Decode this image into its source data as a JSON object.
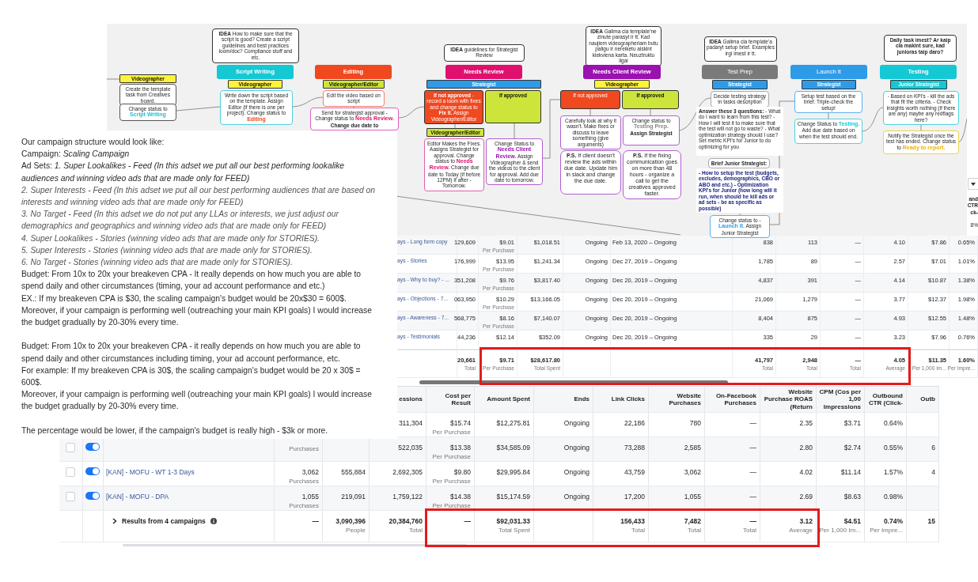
{
  "flowchart": {
    "nodes": [
      {
        "kind": "role",
        "color": "#fff23a",
        "parts": [
          {
            "kind": "bold",
            "text": "Videographer"
          }
        ]
      },
      {
        "kind": "note",
        "color": "#555555",
        "parts": [
          {
            "kind": "plain",
            "text": "Create the template task from Creatives board."
          }
        ]
      },
      {
        "kind": "note",
        "color": "#555555",
        "parts": [
          {
            "kind": "plain",
            "text": "Change status to"
          },
          {
            "kind": "colored",
            "color": "#1fc0d8",
            "text": "Script Writing"
          }
        ]
      },
      {
        "kind": "note",
        "color": "#333333",
        "parts": [
          {
            "kind": "bold",
            "text": "IDEA"
          },
          {
            "kind": "plain",
            "text": "How to make sure that the script is good? Create a script guidelines and best practices loom/doc? Compliance stuff and etc."
          }
        ]
      },
      {
        "kind": "stage",
        "color": "#14c8d4",
        "parts": [
          {
            "kind": "bold",
            "text": "Script Writing"
          }
        ]
      },
      {
        "kind": "role",
        "color": "#fff23a",
        "parts": [
          {
            "kind": "bold",
            "text": "Videographer"
          }
        ]
      },
      {
        "kind": "note",
        "color": "#4fd0e0",
        "parts": [
          {
            "kind": "plain",
            "text": "Write down the script based on the template. Assign Editor (if there is one per project). Change status to"
          },
          {
            "kind": "colored",
            "color": "#f0481f",
            "text": "Editing"
          }
        ]
      },
      {
        "kind": "stage",
        "color": "#f0481f",
        "parts": [
          {
            "kind": "bold",
            "text": "Editing"
          }
        ]
      },
      {
        "kind": "role",
        "color": "#cde53a",
        "parts": [
          {
            "kind": "bold",
            "text": "Videographer/Editor"
          }
        ]
      },
      {
        "kind": "note",
        "color": "#f08070",
        "parts": [
          {
            "kind": "plain",
            "text": "Edit the video based on script"
          }
        ]
      },
      {
        "kind": "note",
        "color": "#e060c0",
        "parts": [
          {
            "kind": "plain",
            "text": "Send for strategist approval - Change status to"
          },
          {
            "kind": "status",
            "color": "#e0106e",
            "text": "Needs Review."
          },
          {
            "kind": "bold",
            "text": "Change due date to"
          }
        ]
      },
      {
        "kind": "note",
        "color": "#333333",
        "parts": [
          {
            "kind": "bold",
            "text": "IDEA"
          },
          {
            "kind": "plain",
            "text": "guidelines for Strategist Review"
          }
        ]
      },
      {
        "kind": "stage",
        "color": "#e0106e",
        "parts": [
          {
            "kind": "bold",
            "text": "Needs Review"
          }
        ]
      },
      {
        "kind": "role",
        "color": "#2d9be8",
        "parts": [
          {
            "kind": "bold",
            "text": "Strategist"
          }
        ]
      },
      {
        "kind": "decision",
        "color": "#f0481f",
        "parts": [
          {
            "kind": "bold",
            "text": "If not approved"
          },
          {
            "kind": "plain",
            "text": "- record a loom with fixes and change status to"
          },
          {
            "kind": "bold",
            "text": "Fix It."
          },
          {
            "kind": "plain",
            "text": "Assign Videographer/Editor"
          }
        ]
      },
      {
        "kind": "decision",
        "color": "#cde53a",
        "parts": [
          {
            "kind": "bold",
            "text": "If approved"
          }
        ]
      },
      {
        "kind": "role",
        "color": "#cde53a",
        "parts": [
          {
            "kind": "bold",
            "text": "Videographer/Editor"
          }
        ]
      },
      {
        "kind": "note",
        "color": "#e060b0",
        "parts": [
          {
            "kind": "plain",
            "text": "Editor Makes the Fixes. Aasigns Strategist for approval. Change status to"
          },
          {
            "kind": "status",
            "color": "#e0106e",
            "text": "Needs Review."
          },
          {
            "kind": "plain",
            "text": "Change due date to Today (if before 12PM) If after - Tomorrow."
          }
        ]
      },
      {
        "kind": "note",
        "color": "#b060d0",
        "parts": [
          {
            "kind": "plain",
            "text": "Change Status to"
          },
          {
            "kind": "colored",
            "color": "#9a12b0",
            "text": "Needs Client Review."
          },
          {
            "kind": "plain",
            "text": "Assign Videographer & send the videos to the client for approval. Add due date to tomorrow."
          }
        ]
      },
      {
        "kind": "note",
        "color": "#333333",
        "parts": [
          {
            "kind": "bold",
            "text": "IDEA"
          },
          {
            "kind": "plain",
            "text": "Galima cia template'ne zinute parasyt ir tt. Kad naujiem videographeriam butu paligu ir nereiketu aiskint kiekviena karta. Neuztruktu ilgai"
          }
        ]
      },
      {
        "kind": "stage",
        "color": "#9a12b0",
        "parts": [
          {
            "kind": "bold",
            "text": "Needs Client Review"
          }
        ]
      },
      {
        "kind": "role",
        "color": "#fff23a",
        "parts": [
          {
            "kind": "bold",
            "text": "Videographer"
          }
        ]
      },
      {
        "kind": "decision",
        "color": "#f0481f",
        "parts": [
          {
            "kind": "plain",
            "text": "If not approved"
          }
        ]
      },
      {
        "kind": "decision",
        "color": "#cde53a",
        "parts": [
          {
            "kind": "bold",
            "text": "If approved"
          }
        ]
      },
      {
        "kind": "note",
        "color": "#b060d0",
        "parts": [
          {
            "kind": "plain",
            "text": "Carefully look at why it wasn't. Make fixes or discuss to leave something (give arguments)"
          }
        ]
      },
      {
        "kind": "note",
        "color": "#b060d0",
        "parts": [
          {
            "kind": "plain",
            "text": "Change status to"
          },
          {
            "kind": "colored",
            "color": "#888888",
            "text": "Testing Prep."
          },
          {
            "kind": "bold",
            "text": "Assign Strategist"
          }
        ]
      },
      {
        "kind": "callout",
        "color": "#b060d0",
        "parts": [
          {
            "kind": "bold",
            "text": "P.S."
          },
          {
            "kind": "plain",
            "text": "If client doesn't review the ads within due date. Update him in slack and change the due date."
          }
        ]
      },
      {
        "kind": "callout",
        "color": "#b060d0",
        "parts": [
          {
            "kind": "bold",
            "text": "P.S."
          },
          {
            "kind": "plain",
            "text": "If the fixing communication goes on more than 48 hours - organize a call to get the creatives approved faster."
          }
        ]
      },
      {
        "kind": "note",
        "color": "#333333",
        "parts": [
          {
            "kind": "bold",
            "text": "IDEA"
          },
          {
            "kind": "plain",
            "text": "Galima cia template'a padaryt setup brief. Examples irgi imest ir tt."
          }
        ]
      },
      {
        "kind": "stage",
        "color": "#7a7a7a",
        "parts": [
          {
            "kind": "plain",
            "text": "Test Prep"
          }
        ]
      },
      {
        "kind": "role",
        "color": "#2d9be8",
        "parts": [
          {
            "kind": "bold",
            "text": "Strategist"
          }
        ]
      },
      {
        "kind": "note",
        "color": "#aaaaaa",
        "parts": [
          {
            "kind": "plain",
            "text": "Decide testing strategy in tasks description"
          }
        ]
      },
      {
        "kind": "plain",
        "color": "#ffffff",
        "parts": [
          {
            "kind": "bold",
            "text": "Answer these 3 questions:"
          },
          {
            "kind": "plain",
            "text": "- What do I want to learn from this test? - How I will test it to make sure that the test will not go to waste? - What optimization strategy should I use? Set metric KPI's for Junior to do optimizing for you"
          }
        ]
      },
      {
        "kind": "note",
        "color": "#aaaaaa",
        "parts": [
          {
            "kind": "bold",
            "text": "Brief Junior Strategist:"
          }
        ]
      },
      {
        "kind": "plain",
        "color": "#ffffff",
        "parts": [
          {
            "kind": "colored",
            "color": "#1a237e",
            "text": "- How to setup the test (budgets, excludes, demographics, CBO or ABO and etc.) - Optimization KPI's for Junior (how long will it run, when should he kill ads or ad sets - be as specific as possible)"
          }
        ]
      },
      {
        "kind": "note",
        "color": "#5ab0f0",
        "parts": [
          {
            "kind": "plain",
            "text": "Change status to -"
          },
          {
            "kind": "colored",
            "color": "#2d9be8",
            "text": "Launch It."
          },
          {
            "kind": "plain",
            "text": "Assign Junior Strategist"
          }
        ]
      },
      {
        "kind": "stage",
        "color": "#2d9be8",
        "parts": [
          {
            "kind": "plain",
            "text": "Launch It"
          }
        ]
      },
      {
        "kind": "role",
        "color": "#2d9be8",
        "parts": [
          {
            "kind": "bold",
            "text": "Strategist"
          }
        ]
      },
      {
        "kind": "note",
        "color": "#5ab0f0",
        "parts": [
          {
            "kind": "plain",
            "text": "Setup test based on the brief. Triple-check the setup!"
          }
        ]
      },
      {
        "kind": "note",
        "color": "#50d0e0",
        "parts": [
          {
            "kind": "plain",
            "text": "Change Status to"
          },
          {
            "kind": "status",
            "color": "#14c8d4",
            "text": "Testing."
          },
          {
            "kind": "plain",
            "text": "Add due date based on when the test should end."
          }
        ]
      },
      {
        "kind": "note",
        "color": "#333333",
        "parts": [
          {
            "kind": "bold",
            "text": "Daily task imest? Ar kaip cia makint sure, kad junioras taip daro?"
          }
        ]
      },
      {
        "kind": "stage",
        "color": "#14c8d4",
        "parts": [
          {
            "kind": "bold",
            "text": "Testing"
          }
        ]
      },
      {
        "kind": "role",
        "color": "#14c8d4",
        "parts": [
          {
            "kind": "bold",
            "text": "Junior Strategist"
          }
        ]
      },
      {
        "kind": "note",
        "color": "#50d0e0",
        "parts": [
          {
            "kind": "plain",
            "text": "- Based on KPI's - kill the ads that fit the criteria. - Check insights worth nothing (if there are any) maybe any redflags here?"
          }
        ]
      },
      {
        "kind": "note",
        "color": "#f0d050",
        "parts": [
          {
            "kind": "plain",
            "text": "Notify the Strategist once the test has ended. Change status to"
          },
          {
            "kind": "status",
            "color": "#f0b400",
            "text": "Ready to report."
          }
        ]
      }
    ]
  },
  "document": {
    "sections": [
      {
        "paragraphs": [
          {
            "kind": "plain",
            "text": "Our campaign structure would look like:"
          },
          {
            "kind": "plain",
            "text": "Campaign: *Scaling Campaign*"
          },
          {
            "kind": "plain",
            "text": "Ad Sets: *1. Super Lookalikes - Feed (In this adset we put all our best performing lookalike audiences and winning video ads that are made only for FEED)*"
          },
          {
            "kind": "item",
            "text": "2. Super Interests - Feed (In this adset we put all our best performing audiences that are based on interests and winning video ads that are made only for FEED)"
          },
          {
            "kind": "item",
            "text": "3. No Target - Feed (In this adset we do not put any LLAs or interests, we just adjust our demographics and geographics and winning video ads that are made only for FEED)"
          },
          {
            "kind": "item",
            "text": "4. Super Lookalikes - Stories (winning video ads that are made only for STORIES)."
          },
          {
            "kind": "item",
            "text": "5. Super Interests - Stories (winning video ads that are made only for STORIES)."
          },
          {
            "kind": "item",
            "text": "6. No Target - Stories (winning video ads that are made only for STORIES)."
          },
          {
            "kind": "plain",
            "text": "Budget: From 10x to 20x your breakeven CPA - It really depends on how much you are able to spend daily and other circumstances (timing, your ad account performance and etc.)"
          },
          {
            "kind": "plain",
            "text": "EX.: If my breakeven CPA is $30, the scaling campaign's budget would be 20x$30 = 600$."
          },
          {
            "kind": "plain",
            "text": "Moreover, if your campaign is performing well (outreaching your main KPI goals) I would increase the budget gradually by 20-30% every time."
          }
        ]
      },
      {
        "paragraphs": [
          {
            "kind": "plain",
            "text": "Budget: From 10x to 20x your breakeven CPA - it really depends on how much you are able to spend daily and other circumstances including timing, your ad account performance, etc."
          },
          {
            "kind": "plain",
            "text": "For example: If my breakeven CPA is 30$, the scaling campaign's budget would be 20 x 30$ = 600$."
          },
          {
            "kind": "plain",
            "text": "Moreover, if your campaign is performing well (outreaching your main KPI goals) I would increase the budget gradually by 20-30% every time."
          }
        ]
      },
      {
        "paragraphs": [
          {
            "kind": "plain",
            "text": "The percentage would be lower, if the campaign's budget is really high - $3k or more."
          }
        ]
      }
    ]
  },
  "ad_sets_table": {
    "corner_header": "and CTR ck-",
    "corner_cell": "8%",
    "rows": [
      {
        "name": {
          "text": "ays - Long form copy"
        },
        "results": {
          "text": "129,609"
        },
        "cost": {
          "text": "$9.01",
          "unit": "Per Purchase"
        },
        "amount": {
          "text": "$1,018.51"
        },
        "ends": {
          "text": "Ongoing"
        },
        "schedule": {
          "text": "Feb 13, 2020 – Ongoing"
        },
        "link_clicks": {
          "text": "838"
        },
        "website_purchases": {
          "text": "113"
        },
        "facebook_purchases": {
          "text": "—"
        },
        "roas": {
          "text": "4.10"
        },
        "cpm": {
          "text": "$7.86"
        },
        "ctr": {
          "text": "0.65%"
        }
      },
      {
        "name": {
          "text": "ays - Stories"
        },
        "results": {
          "text": "176,999"
        },
        "cost": {
          "text": "$13.95",
          "unit": "Per Purchase"
        },
        "amount": {
          "text": "$1,241.34"
        },
        "ends": {
          "text": "Ongoing"
        },
        "schedule": {
          "text": "Dec 27, 2019 – Ongoing"
        },
        "link_clicks": {
          "text": "1,785"
        },
        "website_purchases": {
          "text": "89"
        },
        "facebook_purchases": {
          "text": "—"
        },
        "roas": {
          "text": "2.57"
        },
        "cpm": {
          "text": "$7.01"
        },
        "ctr": {
          "text": "1.01%"
        }
      },
      {
        "name": {
          "text": "ays - Why to buy? - ..."
        },
        "results": {
          "text": "351,208"
        },
        "cost": {
          "text": "$9.76",
          "unit": "Per Purchase"
        },
        "amount": {
          "text": "$3,817.40"
        },
        "ends": {
          "text": "Ongoing"
        },
        "schedule": {
          "text": "Dec 20, 2019 – Ongoing"
        },
        "link_clicks": {
          "text": "4,837"
        },
        "website_purchases": {
          "text": "391"
        },
        "facebook_purchases": {
          "text": "—"
        },
        "roas": {
          "text": "4.14"
        },
        "cpm": {
          "text": "$10.87"
        },
        "ctr": {
          "text": "1.38%"
        }
      },
      {
        "name": {
          "text": "ays - Objections - 7..."
        },
        "results": {
          "text": "063,950"
        },
        "cost": {
          "text": "$10.29",
          "unit": "Per Purchase"
        },
        "amount": {
          "text": "$13,166.05"
        },
        "ends": {
          "text": "Ongoing"
        },
        "schedule": {
          "text": "Dec 20, 2019 – Ongoing"
        },
        "link_clicks": {
          "text": "21,069"
        },
        "website_purchases": {
          "text": "1,279"
        },
        "facebook_purchases": {
          "text": "—"
        },
        "roas": {
          "text": "3.77"
        },
        "cpm": {
          "text": "$12.37"
        },
        "ctr": {
          "text": "1.98%"
        }
      },
      {
        "name": {
          "text": "ays - Awareness - 7..."
        },
        "results": {
          "text": "568,775"
        },
        "cost": {
          "text": "$8.16",
          "unit": "Per Purchase"
        },
        "amount": {
          "text": "$7,140.07"
        },
        "ends": {
          "text": "Ongoing"
        },
        "schedule": {
          "text": "Dec 20, 2019 – Ongoing"
        },
        "link_clicks": {
          "text": "8,404"
        },
        "website_purchases": {
          "text": "875"
        },
        "facebook_purchases": {
          "text": "—"
        },
        "roas": {
          "text": "4.93"
        },
        "cpm": {
          "text": "$12.55"
        },
        "ctr": {
          "text": "1.48%"
        }
      },
      {
        "name": {
          "text": "ays - Testimonials"
        },
        "results": {
          "text": "44,236"
        },
        "cost": {
          "text": "$12.14"
        },
        "amount": {
          "text": "$352.09"
        },
        "ends": {
          "text": "Ongoing"
        },
        "schedule": {
          "text": "Dec 20, 2019 – Ongoing"
        },
        "link_clicks": {
          "text": "335"
        },
        "website_purchases": {
          "text": "29"
        },
        "facebook_purchases": {
          "text": "—"
        },
        "roas": {
          "text": "3.23"
        },
        "cpm": {
          "text": "$7.96"
        },
        "ctr": {
          "text": "0.76%"
        }
      }
    ],
    "total": {
      "results": {
        "text": "20,661",
        "unit": "Total"
      },
      "cost": {
        "text": "$9.71",
        "unit": "Per Purchase"
      },
      "amount": {
        "text": "$28,617.80",
        "unit": "Total Spent"
      },
      "link_clicks": {
        "text": "41,797",
        "unit": "Total"
      },
      "website_purchases": {
        "text": "2,948",
        "unit": "Total"
      },
      "facebook_purchases": {
        "text": "—",
        "unit": "Total"
      },
      "roas": {
        "text": "4.05",
        "unit": "Average"
      },
      "cpm": {
        "text": "$11.35",
        "unit": "Per 1,000 Im..."
      },
      "ctr": {
        "text": "1.60%",
        "unit": "Per Impre..."
      }
    }
  },
  "campaigns_table": {
    "columns": {
      "impressions": "essions",
      "cost": "Cost per Result",
      "amount": "Amount Spent",
      "ends": "Ends",
      "link_clicks": "Link Clicks",
      "website_purchases": "Website Purchases",
      "facebook_purchases": "On-Facebook Purchases",
      "roas": "Website Purchase ROAS (Return",
      "cpm": "CPM (Cos per 1,00 Impressions",
      "ctr": "Outbound CTR (Click-",
      "outbound": "Outb"
    },
    "rows": [
      {
        "impressions": {
          "text": "311,304"
        },
        "cost": {
          "text": "$15.74",
          "unit": "Per Purchase"
        },
        "amount": {
          "text": "$12,275.81"
        },
        "ends": {
          "text": "Ongoing"
        },
        "link_clicks": {
          "text": "22,186"
        },
        "website_purchases": {
          "text": "780"
        },
        "facebook_purchases": {
          "text": "—"
        },
        "roas": {
          "text": "2.35"
        },
        "cpm": {
          "text": "$3.71"
        },
        "ctr": {
          "text": "0.64%"
        }
      },
      {
        "checked": false,
        "on": true,
        "results": {
          "unit": "Purchases"
        },
        "impressions": {
          "text": "522,035"
        },
        "cost": {
          "text": "$13.38",
          "unit": "Per Purchase"
        },
        "amount": {
          "text": "$34,585.09"
        },
        "ends": {
          "text": "Ongoing"
        },
        "link_clicks": {
          "text": "73,288"
        },
        "website_purchases": {
          "text": "2,585"
        },
        "facebook_purchases": {
          "text": "—"
        },
        "roas": {
          "text": "2.80"
        },
        "cpm": {
          "text": "$2.74"
        },
        "ctr": {
          "text": "0.55%"
        },
        "outbound": {
          "text": "6"
        }
      },
      {
        "checked": false,
        "on": true,
        "name": {
          "text": "[KAN] - MOFU - WT 1-3 Days"
        },
        "results": {
          "text": "3,062",
          "unit": "Purchases"
        },
        "reach": {
          "text": "555,884"
        },
        "impressions": {
          "text": "2,692,305"
        },
        "cost": {
          "text": "$9.80",
          "unit": "Per Purchase"
        },
        "amount": {
          "text": "$29,995.84"
        },
        "ends": {
          "text": "Ongoing"
        },
        "link_clicks": {
          "text": "43,759"
        },
        "website_purchases": {
          "text": "3,062"
        },
        "facebook_purchases": {
          "text": "—"
        },
        "roas": {
          "text": "4.02"
        },
        "cpm": {
          "text": "$11.14"
        },
        "ctr": {
          "text": "1.57%"
        },
        "outbound": {
          "text": "4"
        }
      },
      {
        "checked": false,
        "on": true,
        "name": {
          "text": "[KAN] - MOFU - DPA"
        },
        "results": {
          "text": "1,055",
          "unit": "Purchases"
        },
        "reach": {
          "text": "219,091"
        },
        "impressions": {
          "text": "1,759,122"
        },
        "cost": {
          "text": "$14.38",
          "unit": "Per Purchase"
        },
        "amount": {
          "text": "$15,174.59"
        },
        "ends": {
          "text": "Ongoing"
        },
        "link_clicks": {
          "text": "17,200"
        },
        "website_purchases": {
          "text": "1,055"
        },
        "facebook_purchases": {
          "text": "—"
        },
        "roas": {
          "text": "2.69"
        },
        "cpm": {
          "text": "$8.63"
        },
        "ctr": {
          "text": "0.98%"
        }
      }
    ],
    "total": {
      "name": {
        "text": "Results from 4 campaigns"
      },
      "results": {
        "text": "—"
      },
      "reach": {
        "text": "3,090,396",
        "unit": "People"
      },
      "impressions": {
        "text": "20,384,760",
        "unit": "Total"
      },
      "cost": {
        "text": "—"
      },
      "amount": {
        "text": "$92,031.33",
        "unit": "Total Spent"
      },
      "link_clicks": {
        "text": "156,433",
        "unit": "Total"
      },
      "website_purchases": {
        "text": "7,482",
        "unit": "Total"
      },
      "facebook_purchases": {
        "text": "—",
        "unit": "Total"
      },
      "roas": {
        "text": "3.12",
        "unit": "Average"
      },
      "cpm": {
        "text": "$4.51",
        "unit": "Per 1,000 Im..."
      },
      "ctr": {
        "text": "0.74%",
        "unit": "Per Impre..."
      },
      "outbound": {
        "text": "15"
      }
    }
  }
}
